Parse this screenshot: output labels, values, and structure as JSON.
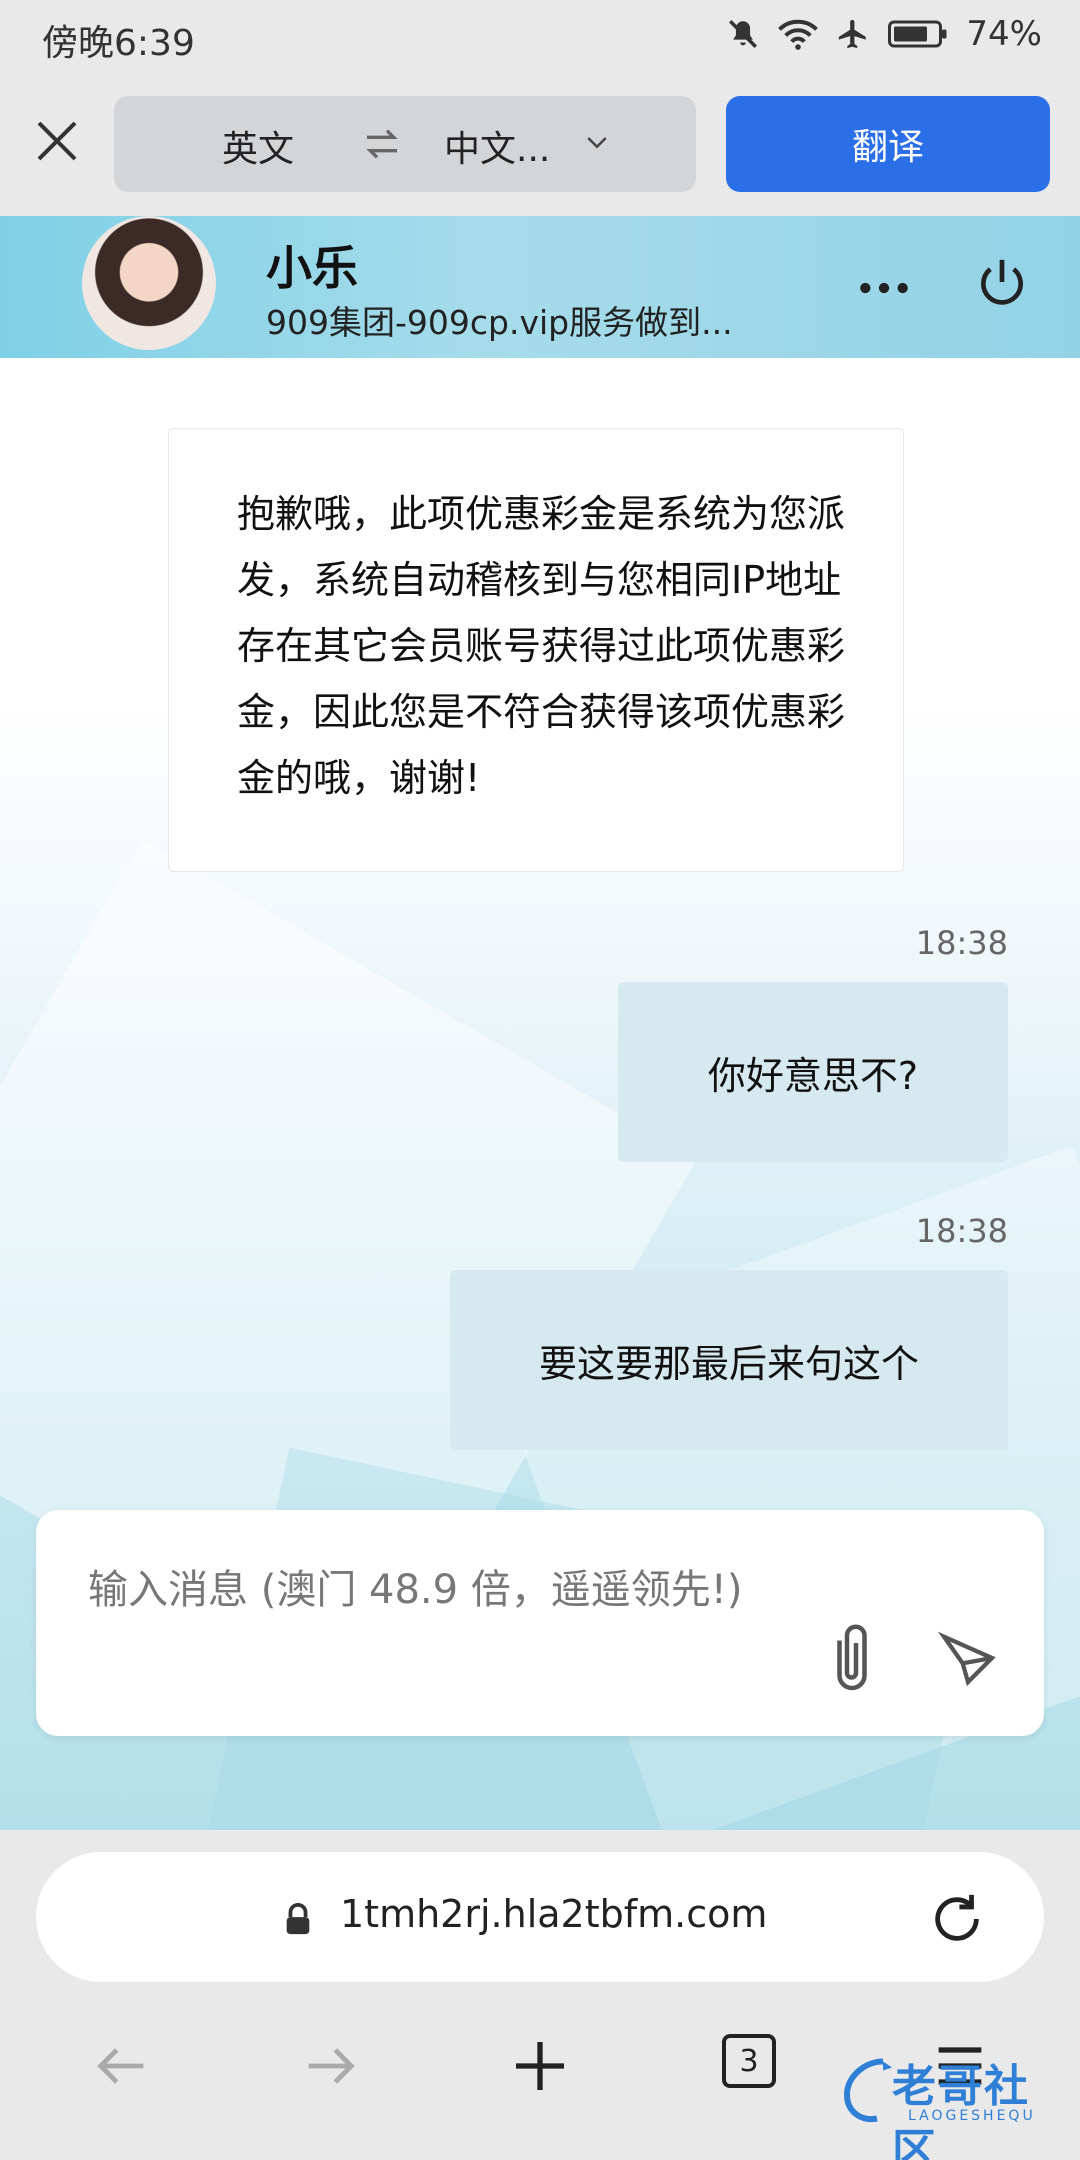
{
  "status_bar": {
    "time": "傍晚6:39",
    "battery": "74%"
  },
  "translate_bar": {
    "source_lang": "英文",
    "target_lang": "中文...",
    "translate_button": "翻译"
  },
  "chat": {
    "agent_name": "小乐",
    "agent_subtitle": "909集团-909cp.vip服务做到...",
    "messages": [
      {
        "side": "left",
        "text": "抱歉哦，此项优惠彩金是系统为您派发，系统自动稽核到与您相同IP地址存在其它会员账号获得过此项优惠彩金，因此您是不符合获得该项优惠彩金的哦，谢谢!"
      },
      {
        "side": "right",
        "time": "18:38",
        "text": "你好意思不?"
      },
      {
        "side": "right",
        "time": "18:38",
        "text": "要这要那最后来句这个"
      }
    ],
    "input_placeholder": "输入消息 (澳门 48.9 倍，遥遥领先!)"
  },
  "browser": {
    "url": "1tmh2rj.hla2tbfm.com",
    "tab_count": "3"
  },
  "watermark": {
    "text": "老哥社区",
    "sub": "LAOGESHEQU"
  },
  "colors": {
    "translate_blue": "#2a6ee8",
    "header_cyan": "#8fd4e8",
    "bubble_right": "#d6e9f0"
  }
}
